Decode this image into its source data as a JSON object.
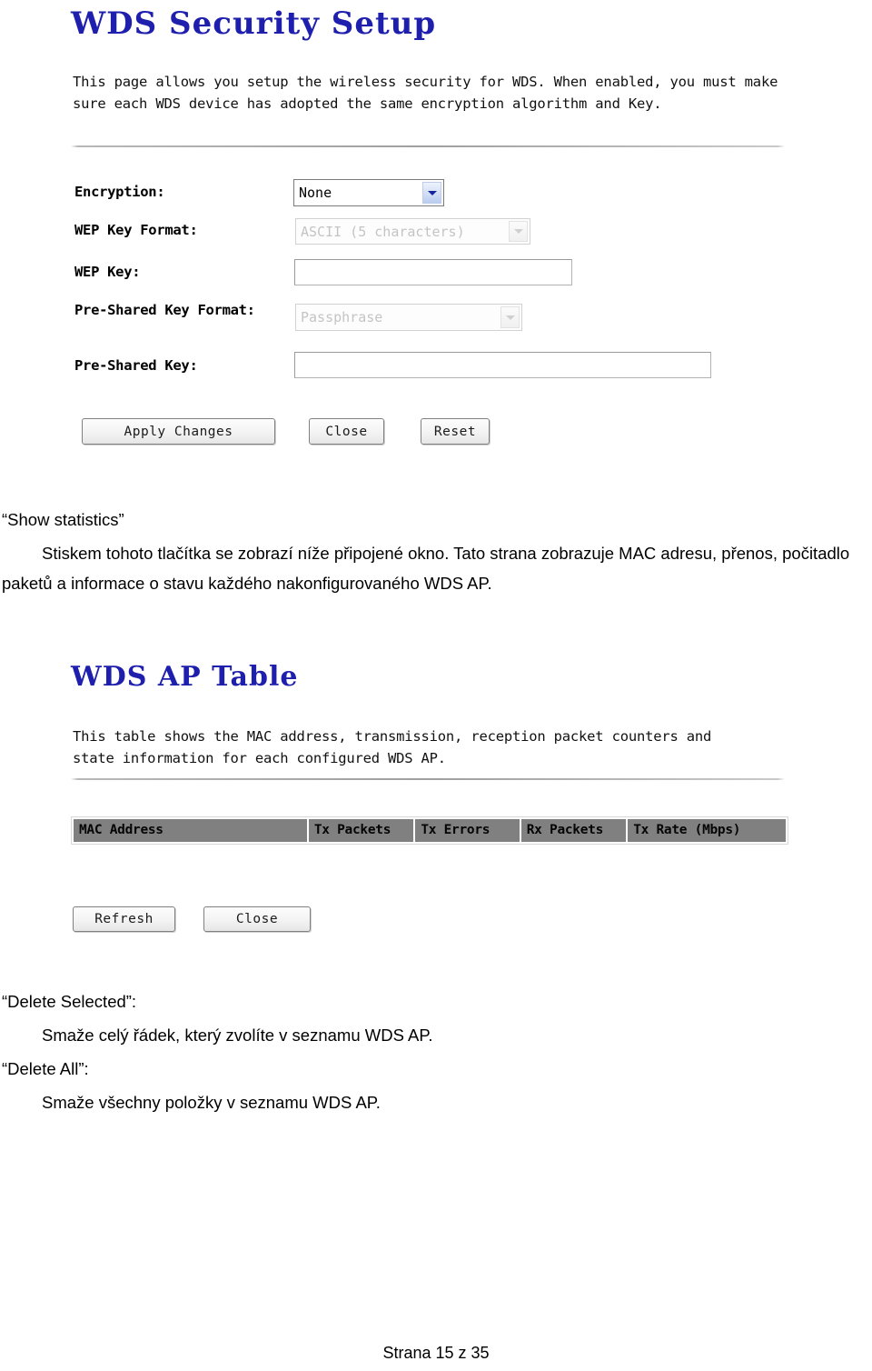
{
  "page": {
    "footer": "Strana 15 z 35"
  },
  "security_panel": {
    "title": "WDS Security Setup",
    "description": "This page allows you setup the wireless security for WDS. When enabled, you must make sure each WDS device has adopted the same encryption algorithm and Key.",
    "fields": {
      "encryption": {
        "label": "Encryption:",
        "value": "None",
        "type": "select",
        "disabled": false
      },
      "wep_key_format": {
        "label": "WEP Key Format:",
        "value": "ASCII (5 characters)",
        "type": "select",
        "disabled": true
      },
      "wep_key": {
        "label": "WEP Key:",
        "value": "",
        "type": "text",
        "disabled": false
      },
      "psk_format": {
        "label": "Pre-Shared Key Format:",
        "value": "Passphrase",
        "type": "select",
        "disabled": true
      },
      "psk": {
        "label": "Pre-Shared Key:",
        "value": "",
        "type": "text",
        "disabled": false
      }
    },
    "buttons": {
      "apply": "Apply Changes",
      "close": "Close",
      "reset": "Reset"
    }
  },
  "prose_show_statistics": {
    "heading": "“Show statistics”",
    "paragraph": "Stiskem tohoto tlačítka se zobrazí níže připojené okno. Tato strana zobrazuje MAC adresu, přenos, počitadlo paketů a informace o stavu každého nakonfigurovaného WDS AP."
  },
  "ap_table_panel": {
    "title": "WDS AP Table",
    "description": "This table shows the MAC address, transmission, reception packet counters and state information for each configured WDS AP.",
    "columns": [
      "MAC Address",
      "Tx Packets",
      "Tx Errors",
      "Rx Packets",
      "Tx Rate (Mbps)"
    ],
    "rows": [],
    "buttons": {
      "refresh": "Refresh",
      "close": "Close"
    }
  },
  "prose_delete": {
    "delete_selected_heading": "“Delete Selected”:",
    "delete_selected_body": "Smaže celý řádek, který zvolíte v seznamu WDS AP.",
    "delete_all_heading": "“Delete All”:",
    "delete_all_body": "Smaže všechny položky v seznamu WDS AP."
  },
  "colors": {
    "panel_title": "#1f1fae",
    "table_header_bg": "#808080",
    "rule": "#9f9f9f",
    "text": "#000000"
  }
}
